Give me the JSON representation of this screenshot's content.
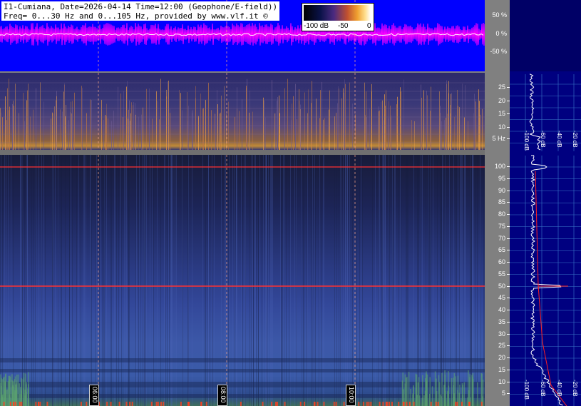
{
  "title": {
    "line1": "I1-Cumiana, Date=2026-04-14 Time=12:00 (Geophone/E-field))",
    "line2": "Freq= 0...30 Hz and 0...105 Hz, provided by www.vlf.it ©"
  },
  "colorbar": {
    "ticks": [
      "-100 dB",
      "-50",
      "0"
    ]
  },
  "waveform_scale": [
    "50 %",
    "0 %",
    "-50 %"
  ],
  "low_freq_scale": [
    "25",
    "20",
    "15",
    "10",
    "5 Hz"
  ],
  "high_freq_scale": [
    "100",
    "95",
    "90",
    "85",
    "80",
    "75",
    "70",
    "65",
    "60",
    "55",
    "50",
    "45",
    "40",
    "35",
    "30",
    "25",
    "20",
    "15",
    "10",
    "5"
  ],
  "avg_spectrum": {
    "low_labels": [
      "-100 dB",
      "-60 dB",
      "-40 dB",
      "-20 dB"
    ],
    "high_labels": [
      "-100 dB",
      "-60 dB",
      "-40 dB",
      "-20 dB"
    ]
  },
  "time_markers": [
    "06:00",
    "08:00",
    "10:00"
  ],
  "colors": {
    "waveform_bg": "#0000ff",
    "waveform_trace": "#ff00ff",
    "avg_bg": "#000080",
    "mains_line": "#ff3030"
  }
}
